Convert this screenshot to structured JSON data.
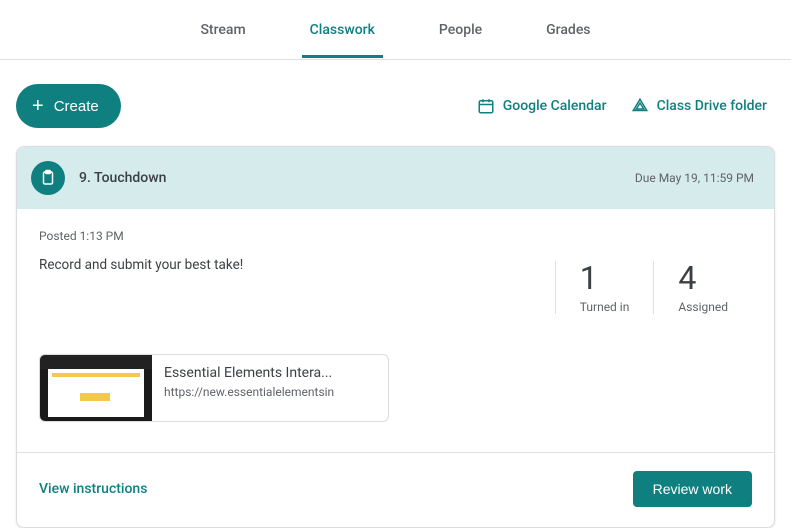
{
  "tabs": {
    "stream": "Stream",
    "classwork": "Classwork",
    "people": "People",
    "grades": "Grades"
  },
  "toolbar": {
    "create": "Create",
    "calendar": "Google Calendar",
    "drive": "Class Drive folder"
  },
  "assignment": {
    "title": "9. Touchdown",
    "due": "Due May 19, 11:59 PM",
    "posted": "Posted 1:13 PM",
    "description": "Record and submit your best take!",
    "stats": {
      "turned_in_num": "1",
      "turned_in_label": "Turned in",
      "assigned_num": "4",
      "assigned_label": "Assigned"
    },
    "attachment": {
      "title": "Essential Elements Intera...",
      "url": "https://new.essentialelementsin"
    },
    "view_instructions": "View instructions",
    "review_work": "Review work"
  }
}
